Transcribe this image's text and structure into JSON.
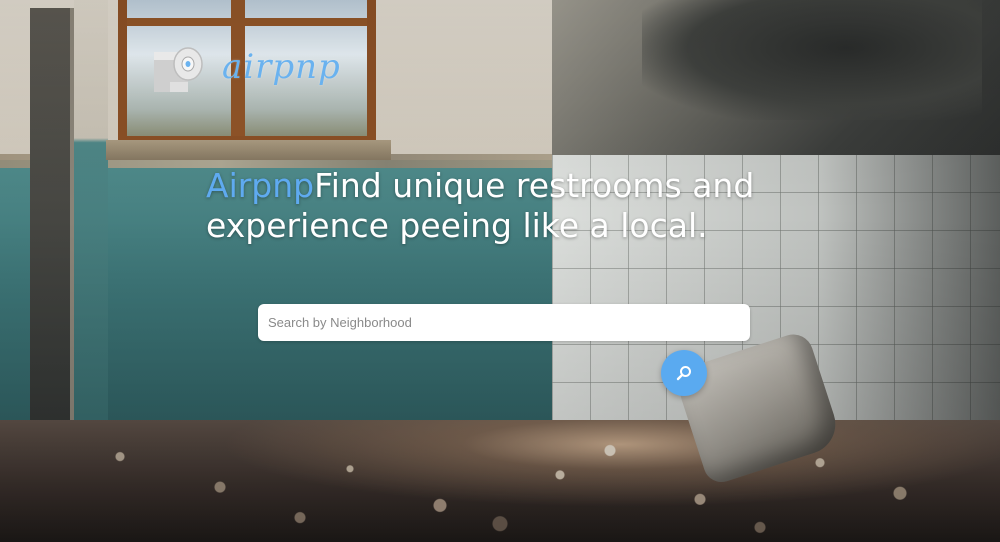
{
  "logo": {
    "wordmark": "airpnp",
    "icon": "toilet-paper-roll-icon"
  },
  "hero": {
    "brand": "Airpnp",
    "tagline": "Find unique restrooms and experience peeing like a local."
  },
  "search": {
    "placeholder": "Search by Neighborhood",
    "value": "",
    "button_icon": "search-icon"
  },
  "colors": {
    "brand_blue": "#5aaaf0",
    "headline_text": "#ffffff"
  }
}
